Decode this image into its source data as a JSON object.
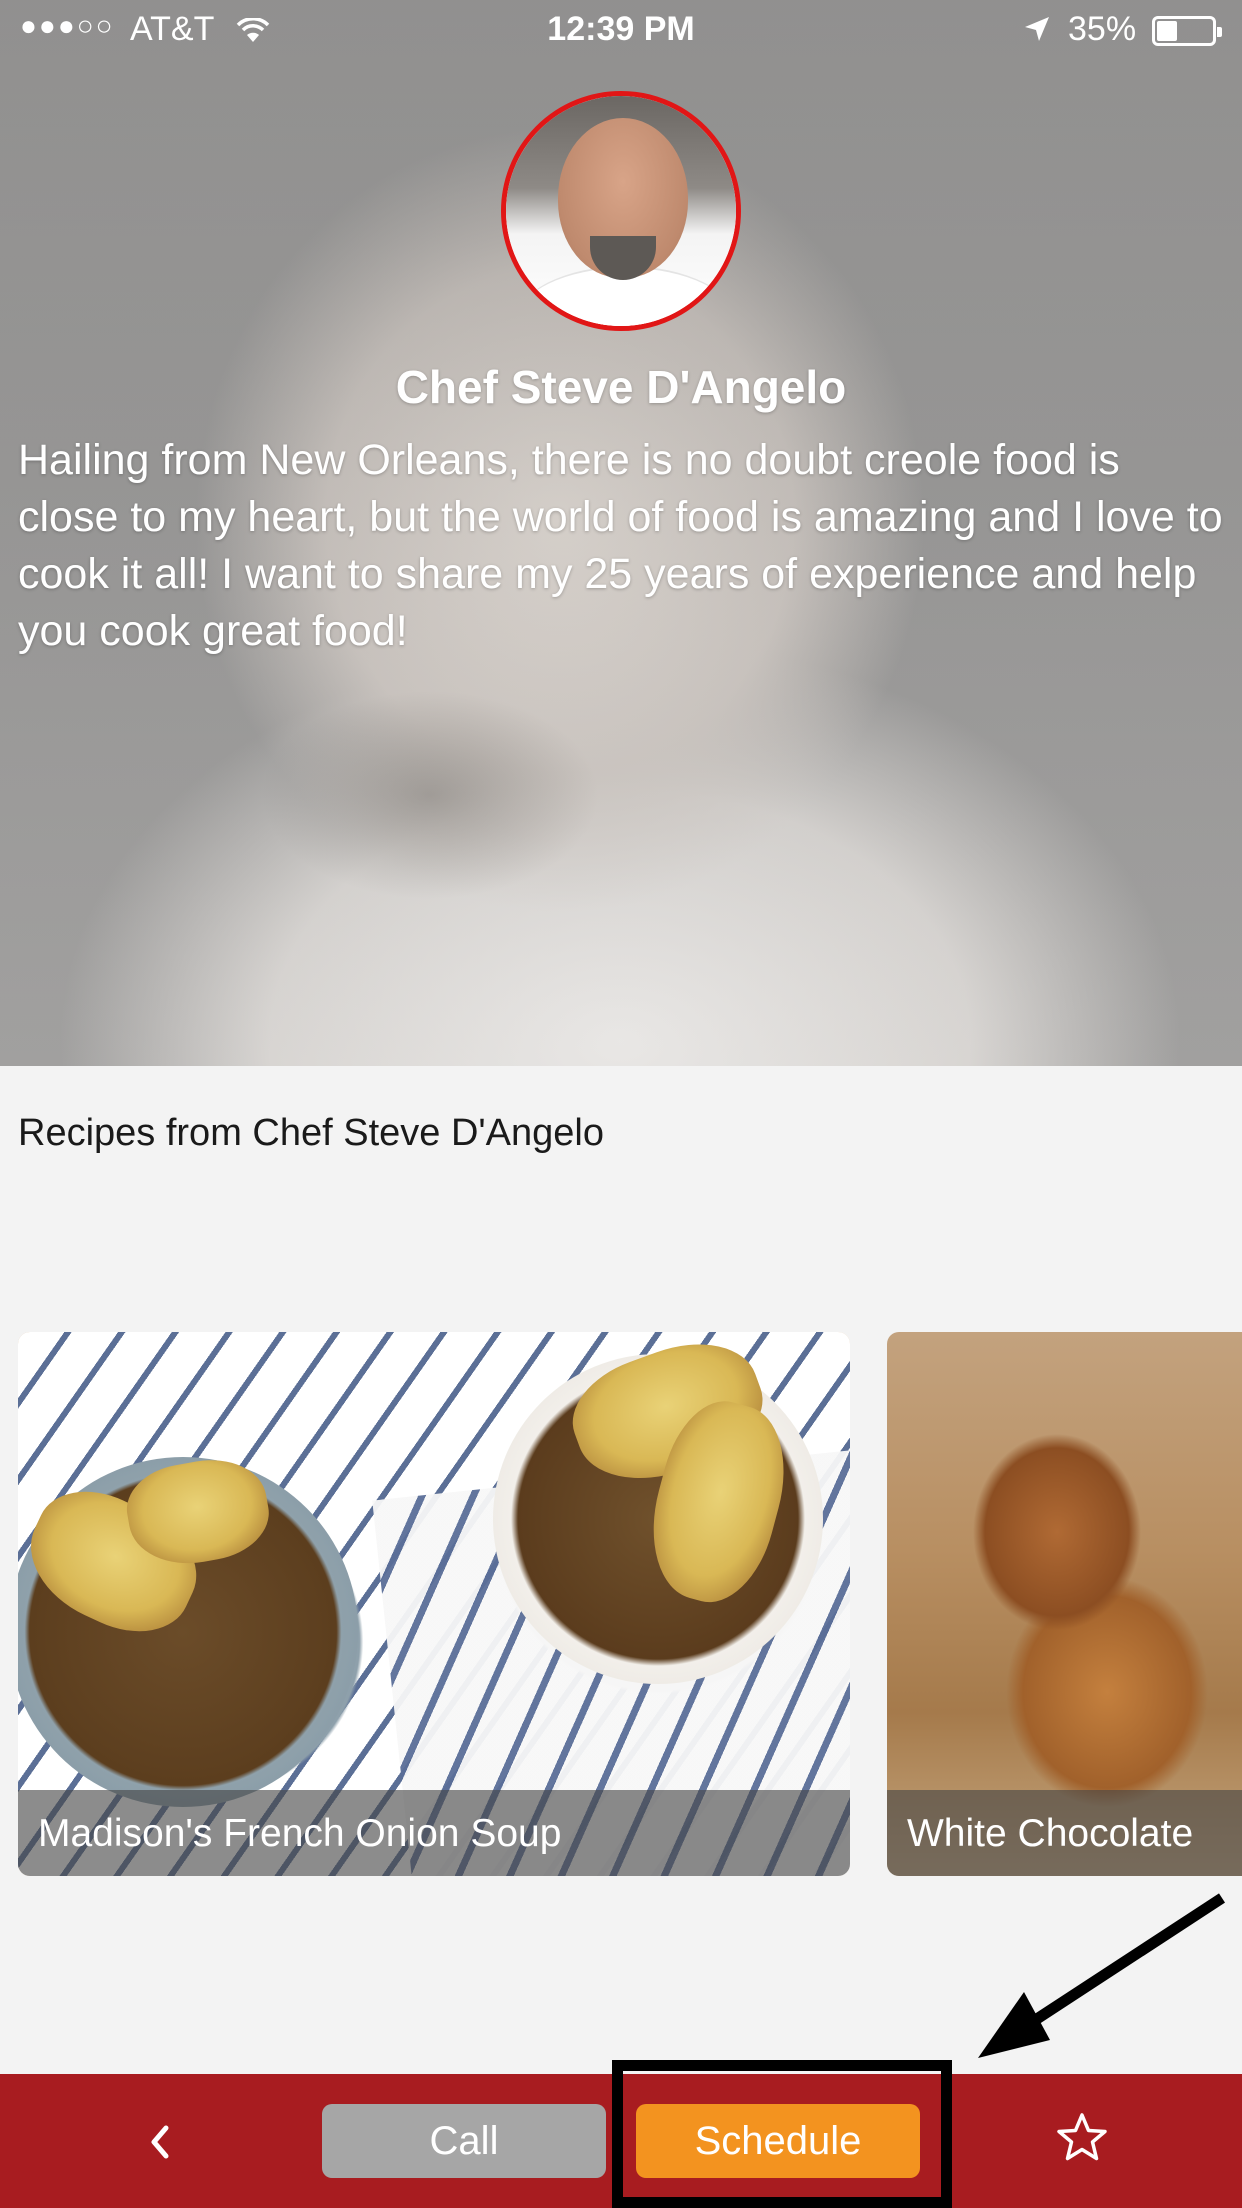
{
  "status_bar": {
    "signal": "●●●○○",
    "carrier": "AT&T",
    "time": "12:39 PM",
    "battery_percent": "35%",
    "battery_level": 0.35
  },
  "chef": {
    "name": "Chef Steve D'Angelo",
    "bio": "Hailing from New Orleans, there is no doubt creole food is close to my heart, but the world of food is amazing and I love to cook it all! I want to share my 25 years of experience and help you cook great food!"
  },
  "recipes": {
    "heading": "Recipes from Chef Steve D'Angelo",
    "items": [
      {
        "title": "Madison's French Onion Soup"
      },
      {
        "title": "White Chocolate"
      }
    ]
  },
  "bottom_bar": {
    "call_label": "Call",
    "schedule_label": "Schedule"
  },
  "colors": {
    "bottom_bar": "#a81c20",
    "schedule_button": "#f3931f",
    "call_button": "#a6a6a6",
    "avatar_ring": "#e11616"
  }
}
